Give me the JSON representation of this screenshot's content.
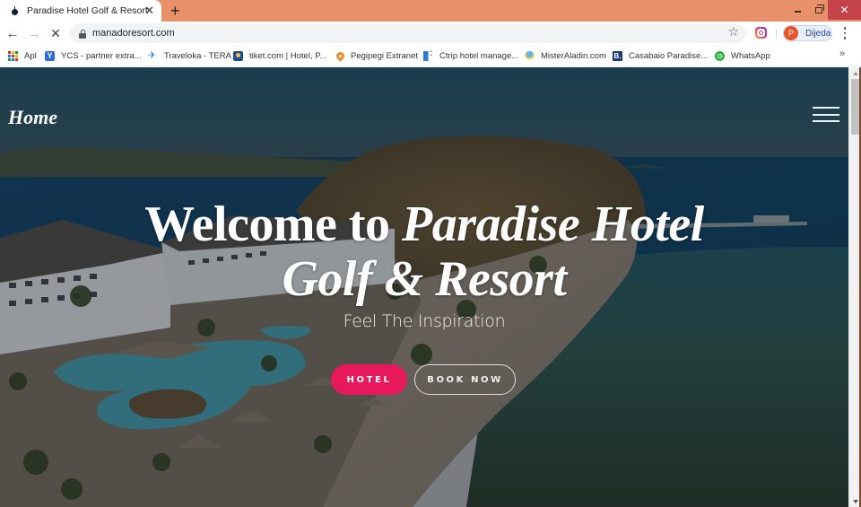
{
  "browser": {
    "tab": {
      "title": "Paradise Hotel Golf & Resort",
      "close_icon": "✕",
      "favicon": "resort-logo-icon"
    },
    "new_tab_icon": "+",
    "window_controls": {
      "minimize": "minimize-icon",
      "restore": "restore-icon",
      "close": "✕"
    },
    "nav": {
      "back_icon": "←",
      "forward_icon": "→",
      "stop_icon": "✕"
    },
    "url": "manadoresort.com",
    "star_icon": "☆",
    "profile": {
      "initial": "P",
      "name": "Dijeda"
    },
    "bookmarks": [
      {
        "label": "Apl",
        "icon": "apps-grid-icon"
      },
      {
        "label": "YCS - partner extra...",
        "icon": "ycs-icon",
        "glyph": "Y"
      },
      {
        "label": "Traveloka - TERA",
        "icon": "traveloka-bird-icon",
        "glyph": "✈"
      },
      {
        "label": "tiket.com | Hotel, P...",
        "icon": "tiket-icon"
      },
      {
        "label": "Pegipegi Extranet",
        "icon": "pegipegi-pin-icon"
      },
      {
        "label": "Ctrip hotel manage...",
        "icon": "ctrip-icon"
      },
      {
        "label": "MisterAladin.com",
        "icon": "misteraladin-icon"
      },
      {
        "label": "Casabaio Paradise...",
        "icon": "booking-icon",
        "glyph": "B."
      },
      {
        "label": "WhatsApp",
        "icon": "whatsapp-icon"
      }
    ],
    "bookmarks_more": "»"
  },
  "page": {
    "brand": "Home",
    "headline": {
      "line1_plain": "Welcome to ",
      "line1_italic": "Paradise Hotel",
      "line2": "Golf & Resort"
    },
    "tagline": "Feel The Inspiration",
    "buttons": {
      "hotel": "HOTEL",
      "book_now": "BOOK NOW"
    }
  },
  "colors": {
    "titlebar": "#e8906a",
    "accent_button": "#e8185c",
    "profile_avatar": "#e8532c",
    "window_close": "#c4424a"
  }
}
